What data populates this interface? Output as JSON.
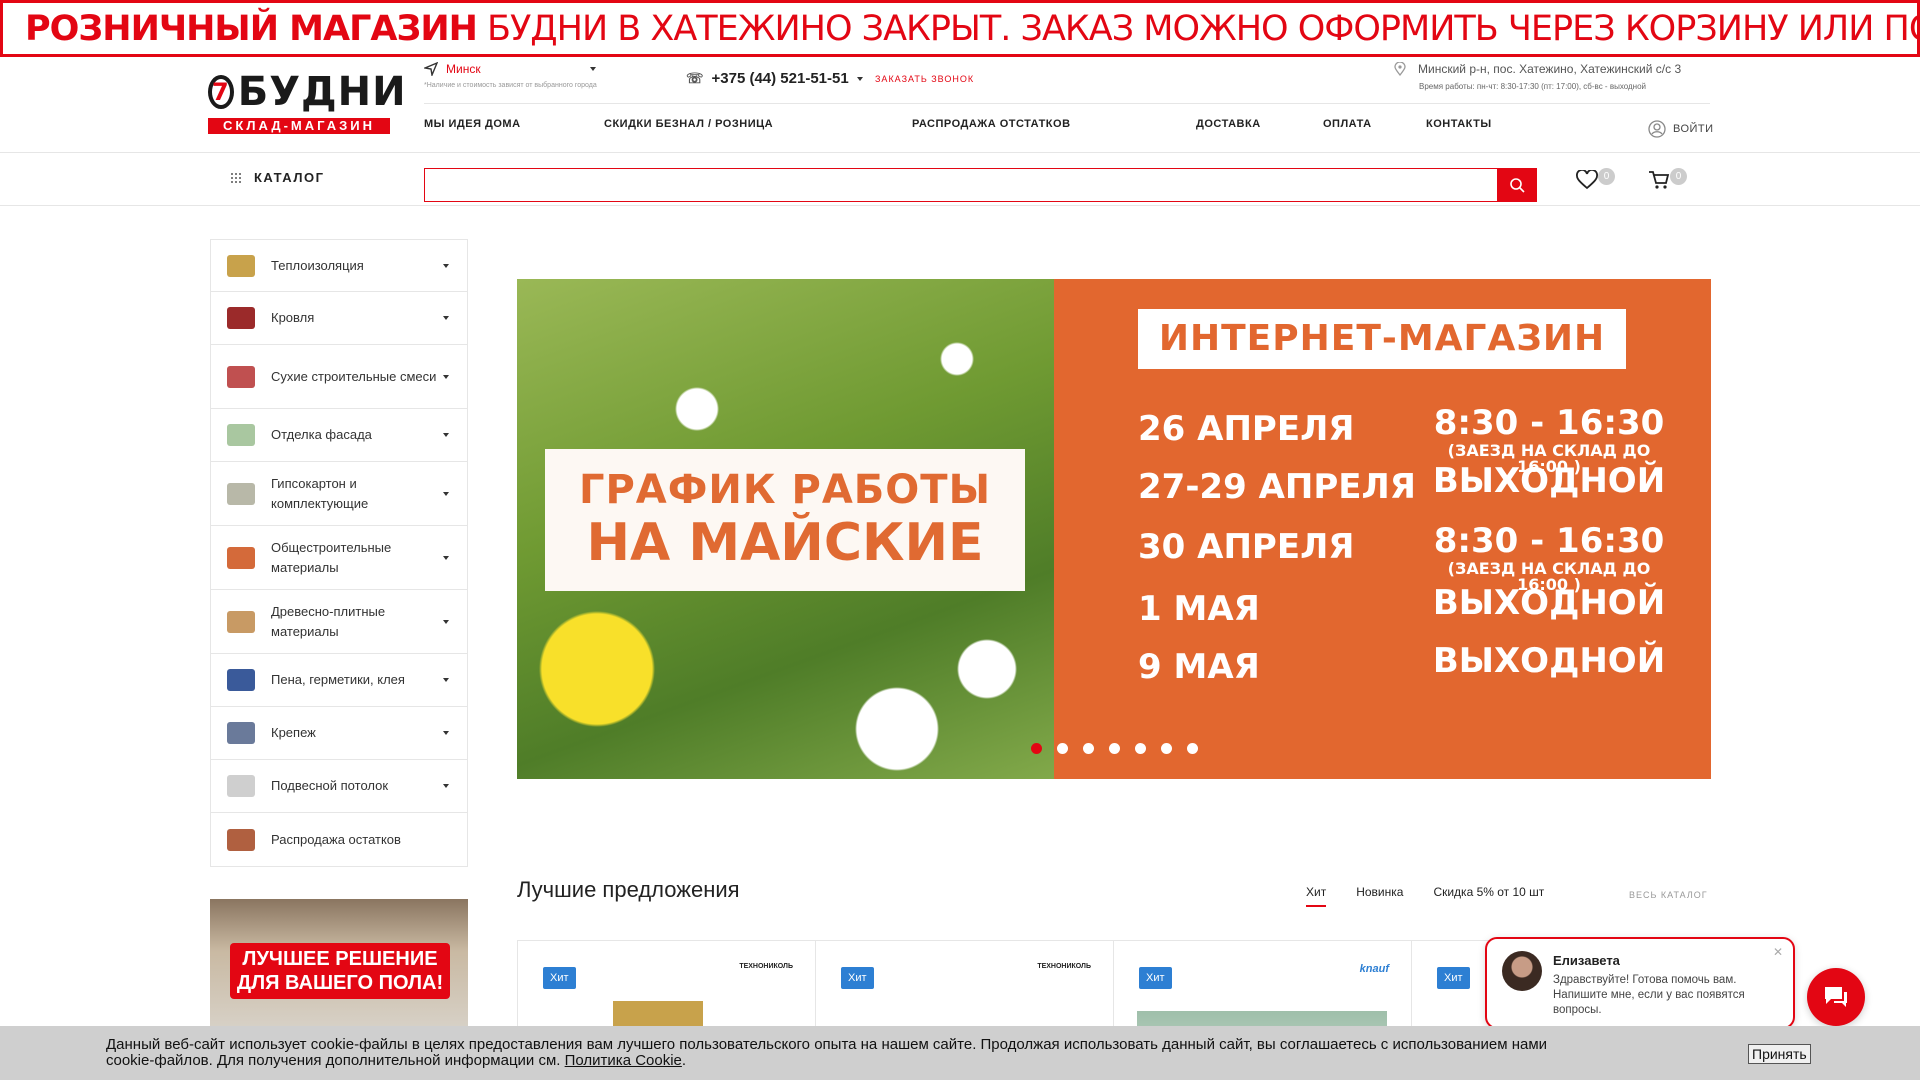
{
  "banner": {
    "bold": "РОЗНИЧНЫЙ МАГАЗИН",
    "text": "БУДНИ В ХАТЕЖИНО ЗАКРЫТ. ЗАКАЗ МОЖНО ОФОРМИТЬ ЧЕРЕЗ КОРЗИНУ ИЛИ ПО ТЕЛЕФОНУ"
  },
  "logo": {
    "number": "7",
    "word": "БУДНИ",
    "strip": "СКЛАД-МАГАЗИН"
  },
  "header": {
    "city": "Минск",
    "city_note": "*Наличие и стоимость зависят от выбранного города",
    "phone": "+375 (44) 521-51-51",
    "callback": "ЗАКАЗАТЬ ЗВОНОК",
    "address": "Минский р-н, пос. Хатежино, Хатежинский с/с 3",
    "hours": "Время работы: пн-чт: 8:30-17:30 (пт: 17:00), сб-вс - выходной",
    "login": "ВОЙТИ"
  },
  "nav": [
    "МЫ ИДЕЯ ДОМА",
    "СКИДКИ БЕЗНАЛ / РОЗНИЦА",
    "РАСПРОДАЖА ОТСТАТКОВ",
    "ДОСТАВКА",
    "ОПЛАТА",
    "КОНТАКТЫ"
  ],
  "catalog": {
    "label": "КАТАЛОГ",
    "search_placeholder": "",
    "fav_count": "0",
    "cart_count": "0"
  },
  "sidebar": [
    {
      "label": "Теплоизоляция",
      "color": "#c8a24b"
    },
    {
      "label": "Кровля",
      "color": "#9b2a2a"
    },
    {
      "label": "Сухие строительные смеси",
      "color": "#c05050"
    },
    {
      "label": "Отделка фасада",
      "color": "#a9c7a0"
    },
    {
      "label": "Гипсокартон и комплектующие",
      "color": "#b8b8a8"
    },
    {
      "label": "Общестроительные материалы",
      "color": "#d46a3a"
    },
    {
      "label": "Древесно-плитные материалы",
      "color": "#c89a64"
    },
    {
      "label": "Пена, герметики, клея",
      "color": "#3a5a9a"
    },
    {
      "label": "Крепеж",
      "color": "#6a7a9a"
    },
    {
      "label": "Подвесной потолок",
      "color": "#cfcfcf"
    },
    {
      "label": "Распродажа остатков",
      "color": "#b06040"
    }
  ],
  "promo": {
    "line1": "ЛУЧШЕЕ РЕШЕНИЕ",
    "line2": "ДЛЯ ВАШЕГО ПОЛА!"
  },
  "slide": {
    "left_l1": "ГРАФИК РАБОТЫ",
    "left_l2": "НА МАЙСКИЕ",
    "head": "ИНТЕРНЕТ-МАГАЗИН",
    "rows": [
      {
        "date": "26 АПРЕЛЯ",
        "time": "8:30 - 16:30",
        "sub": "(ЗАЕЗД НА СКЛАД ДО 16:00 )"
      },
      {
        "date": "27-29 АПРЕЛЯ",
        "time": "ВЫХОДНОЙ",
        "sub": ""
      },
      {
        "date": "30 АПРЕЛЯ",
        "time": "8:30 - 16:30",
        "sub": "(ЗАЕЗД НА СКЛАД ДО 16:00 )"
      },
      {
        "date": "1 МАЯ",
        "time": "ВЫХОДНОЙ",
        "sub": ""
      },
      {
        "date": "9 МАЯ",
        "time": "ВЫХОДНОЙ",
        "sub": ""
      }
    ],
    "dots": 7,
    "active_dot": 0
  },
  "best": {
    "title": "Лучшие предложения",
    "tabs": [
      "Хит",
      "Новинка",
      "Скидка 5% от 10 шт"
    ],
    "all": "ВЕСЬ КАТАЛОГ",
    "cards": [
      {
        "badge": "Хит",
        "brand": "ТЕХНОНИКОЛЬ"
      },
      {
        "badge": "Хит",
        "brand": "ТЕХНОНИКОЛЬ"
      },
      {
        "badge": "Хит",
        "brand": "knauf"
      },
      {
        "badge": "Хит",
        "brand": ""
      }
    ]
  },
  "chat": {
    "name": "Елизавета",
    "message": "Здравствуйте! Готова помочь вам. Напишите мне, если у вас появятся вопросы."
  },
  "cookie": {
    "text": "Данный веб-сайт использует cookie-файлы в целях предоставления вам лучшего пользовательского опыта на нашем сайте. Продолжая использовать данный сайт, вы соглашаетесь с использованием нами cookie-файлов. Для получения дополнительной информации см.",
    "link": "Политика Cookie",
    "accept": "Принять"
  }
}
